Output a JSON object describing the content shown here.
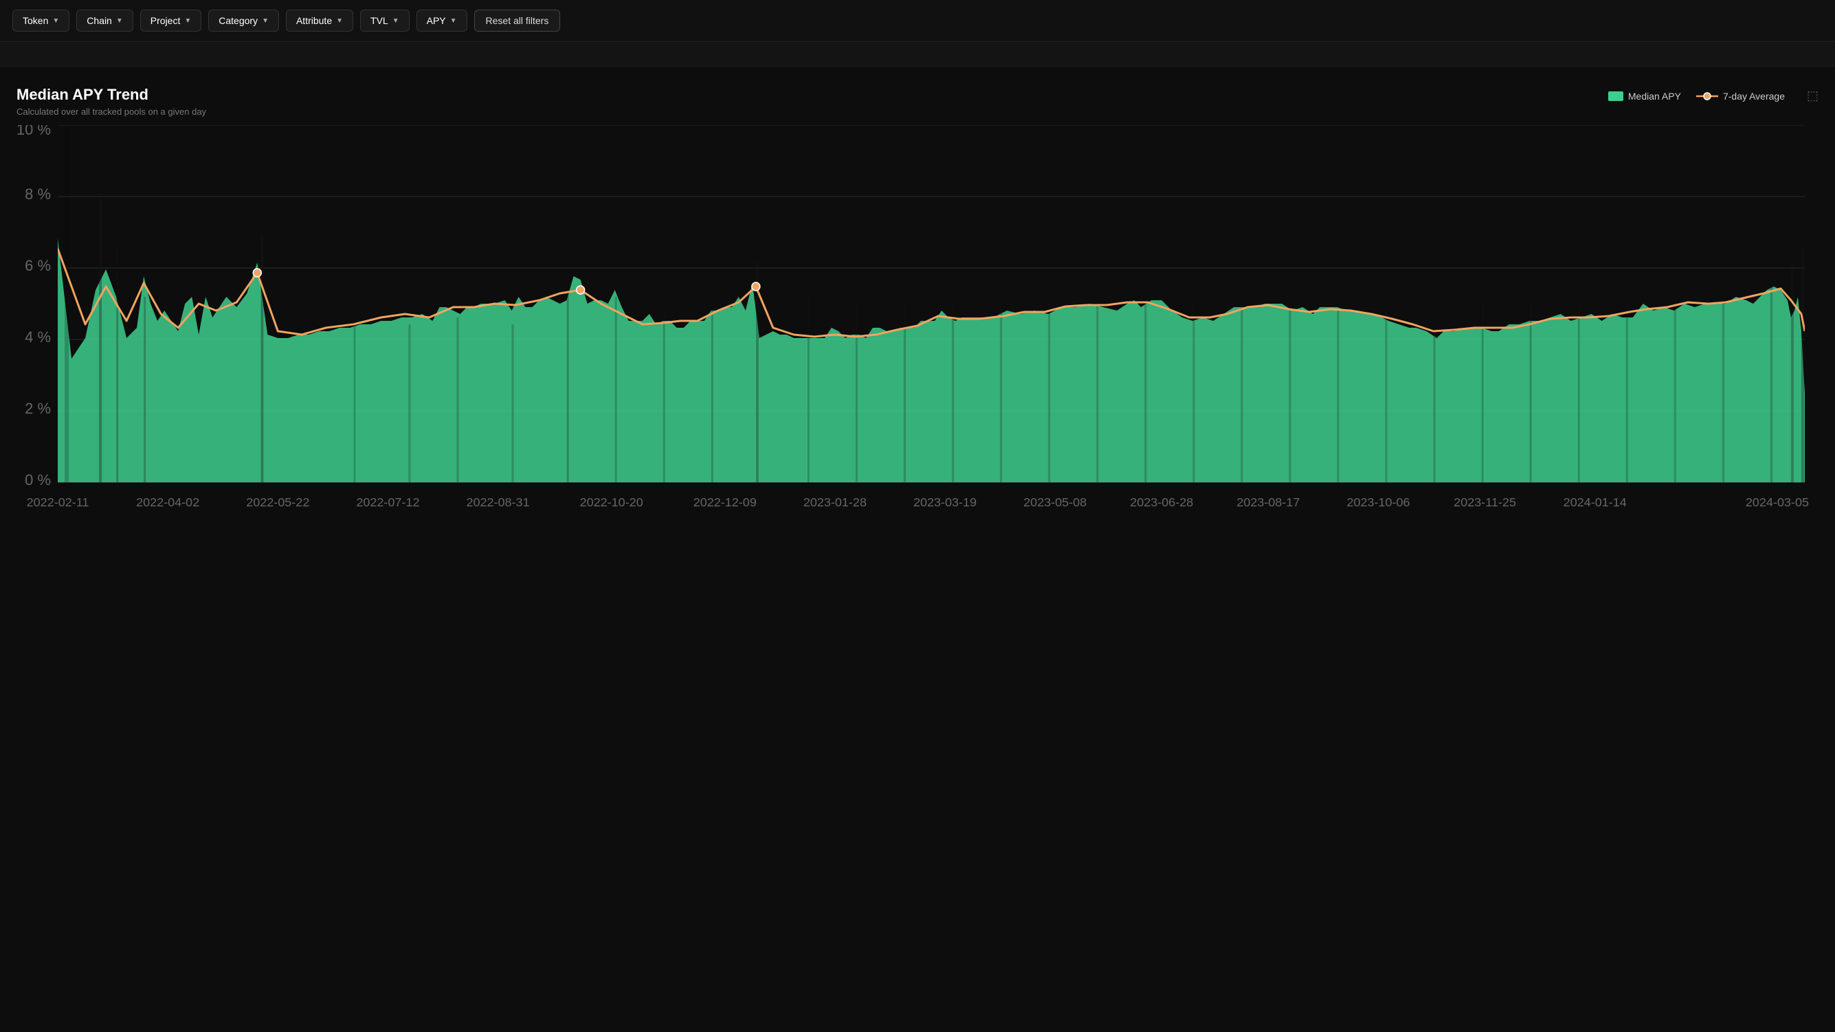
{
  "filterBar": {
    "buttons": [
      {
        "label": "Token",
        "id": "token"
      },
      {
        "label": "Chain",
        "id": "chain"
      },
      {
        "label": "Project",
        "id": "project"
      },
      {
        "label": "Category",
        "id": "category"
      },
      {
        "label": "Attribute",
        "id": "attribute"
      },
      {
        "label": "TVL",
        "id": "tvl"
      },
      {
        "label": "APY",
        "id": "apy"
      }
    ],
    "resetLabel": "Reset all filters"
  },
  "chart": {
    "title": "Median APY Trend",
    "subtitle": "Calculated over all tracked pools on a given day",
    "legend": {
      "medianLabel": "Median APY",
      "avgLabel": "7-day Average"
    },
    "yAxis": {
      "labels": [
        "0 %",
        "2 %",
        "4 %",
        "6 %",
        "8 %",
        "10 %"
      ]
    },
    "xAxis": {
      "labels": [
        "2022-02-11",
        "2022-04-02",
        "2022-05-22",
        "2022-07-12",
        "2022-08-31",
        "2022-10-20",
        "2022-12-09",
        "2023-01-28",
        "2023-03-19",
        "2023-05-08",
        "2023-06-28",
        "2023-08-17",
        "2023-10-06",
        "2023-11-25",
        "2024-01-14",
        "2024-03-05"
      ]
    }
  }
}
